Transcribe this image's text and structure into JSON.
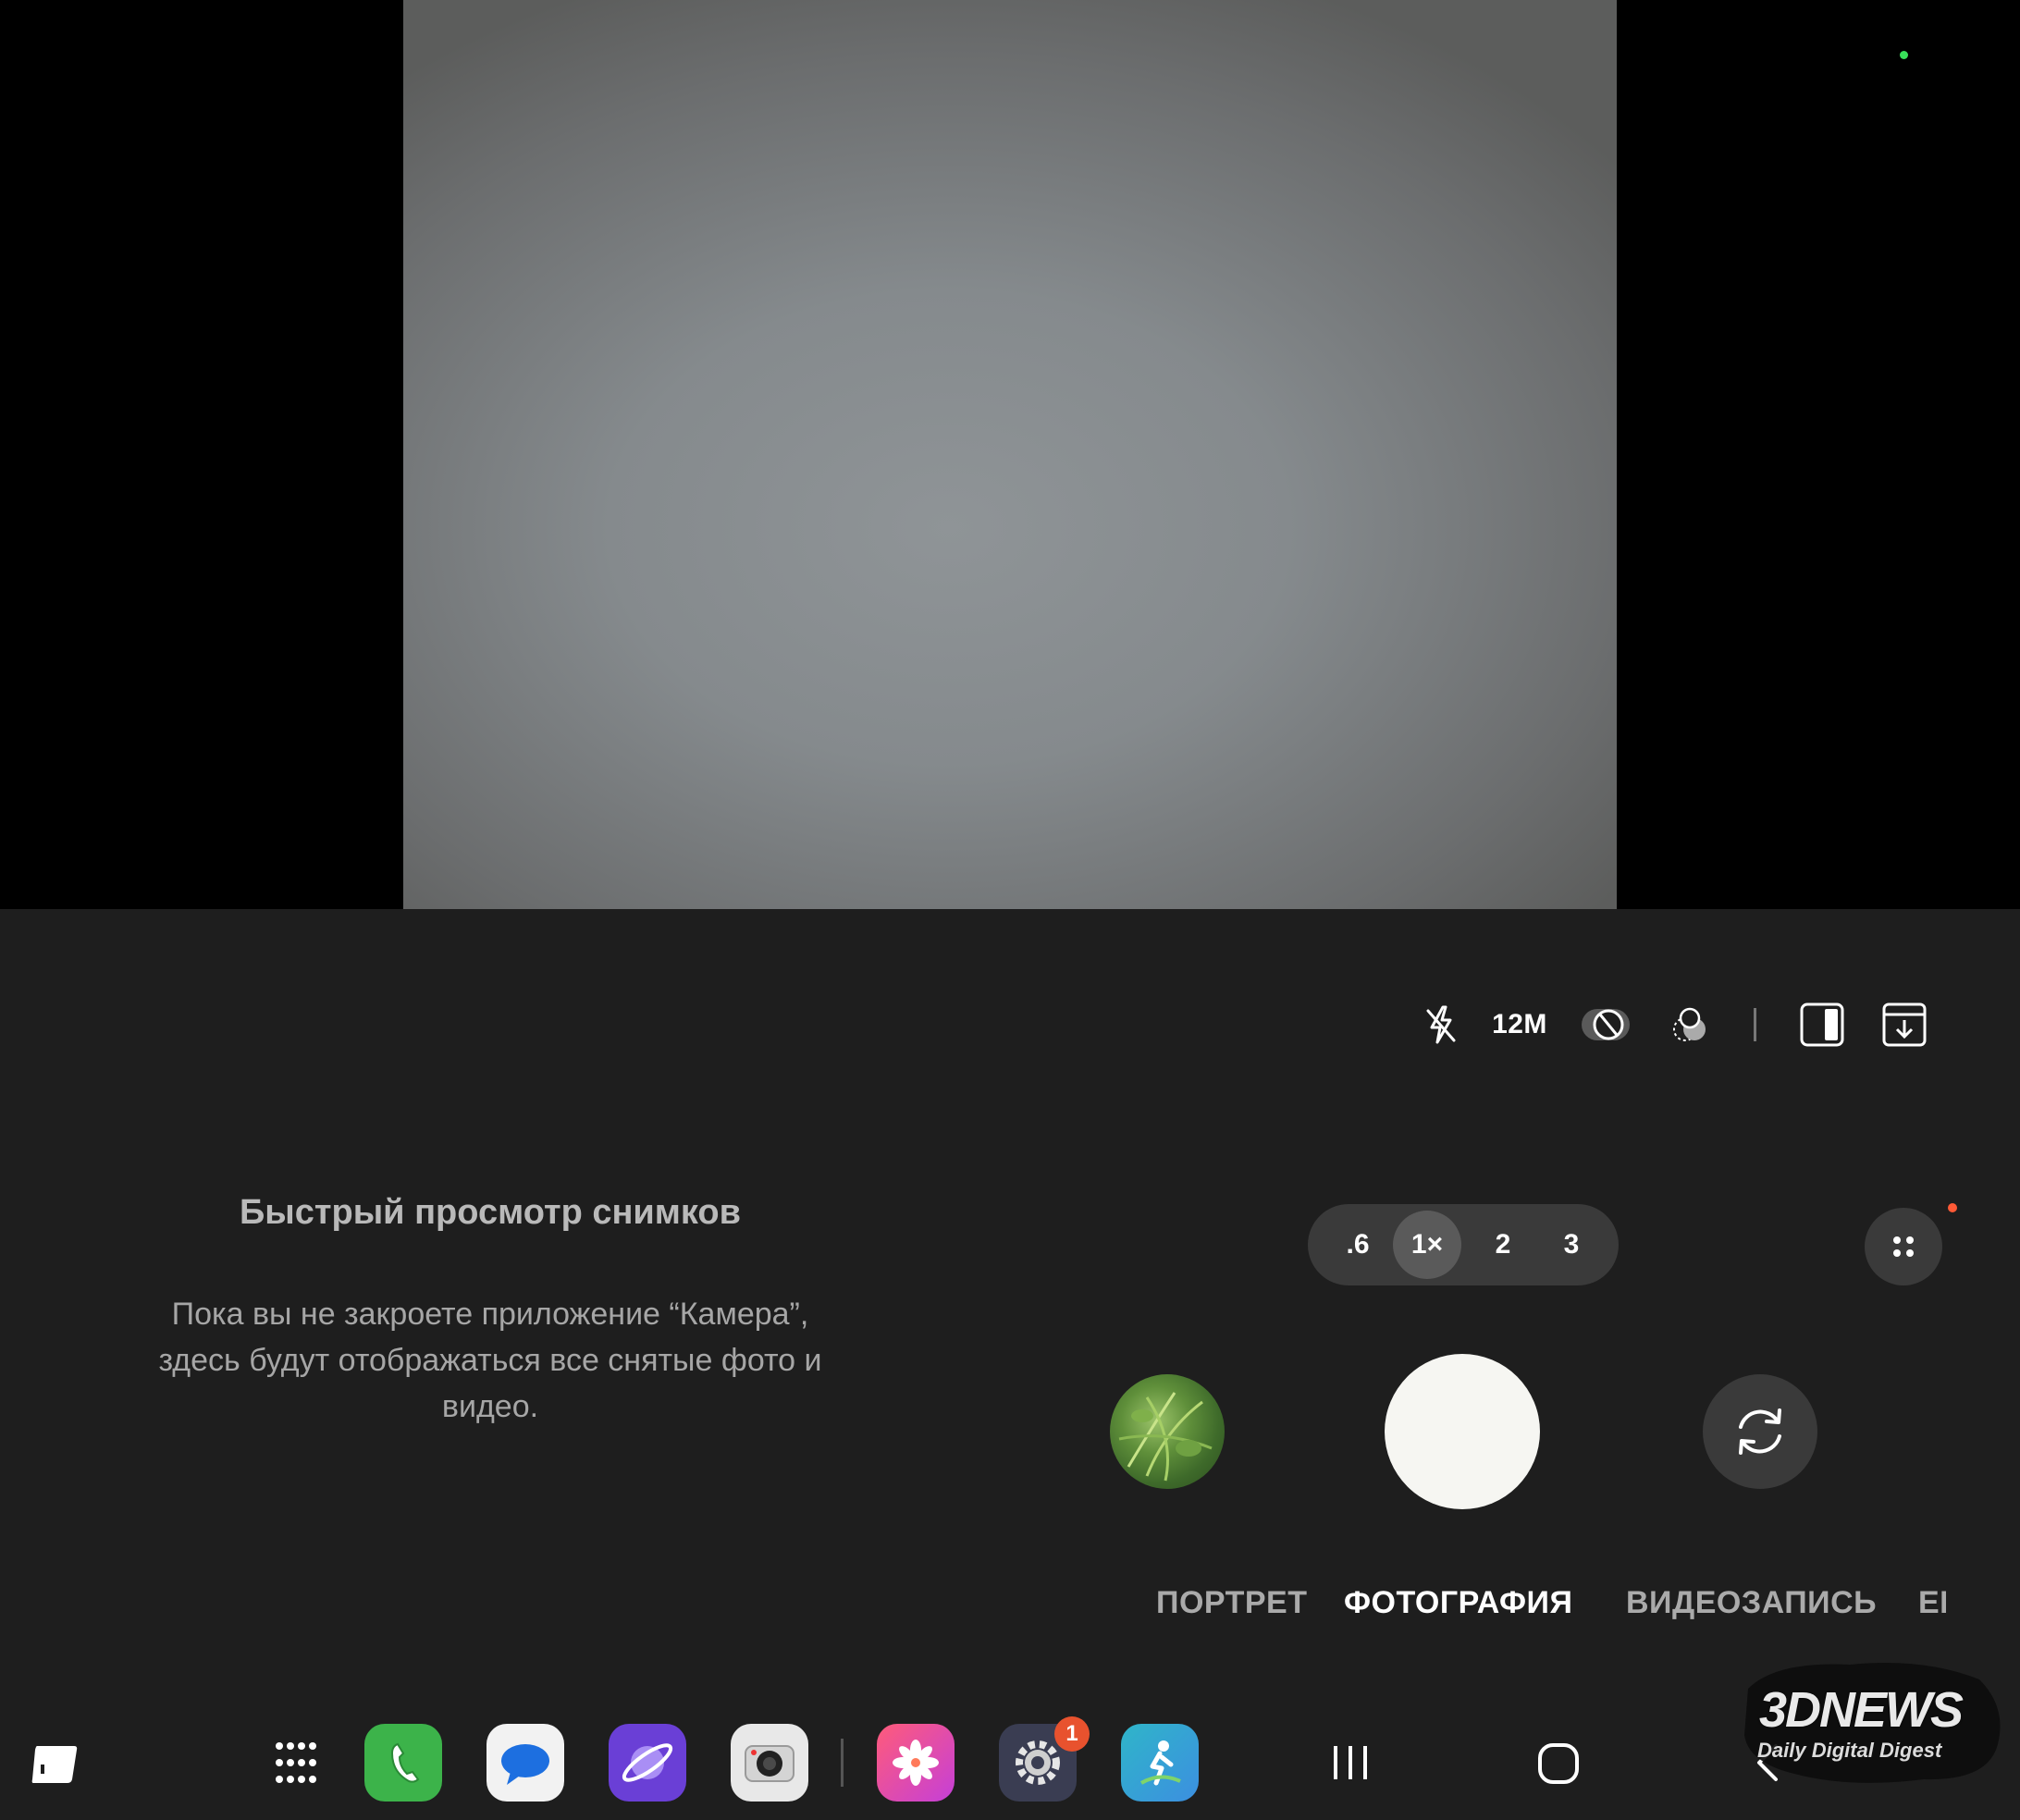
{
  "quick_settings": {
    "flash_icon": "flash-off-icon",
    "resolution": "12M",
    "icons": [
      "motion-photo-off-icon",
      "filters-icon",
      "aspect-ratio-icon",
      "save-options-icon"
    ]
  },
  "quick_preview": {
    "title": "Быстрый просмотр снимков",
    "body": "Пока вы не закроете приложение “Камера”, здесь будут отображаться все снятые фото и видео."
  },
  "zoom": {
    "options": [
      ".6",
      "1×",
      "2",
      "3"
    ],
    "selected": "1×"
  },
  "modes": {
    "portrait": "ПОРТРЕТ",
    "photo": "ФОТОГРАФИЯ",
    "video": "ВИДЕОЗАПИСЬ",
    "more_cut": "ЕЩЁ",
    "selected": "ФОТОГРАФИЯ"
  },
  "taskbar": {
    "apps": [
      "apps-grid-icon",
      "phone-icon",
      "messages-icon",
      "internet-icon",
      "camera-icon",
      "gallery-icon",
      "settings-icon",
      "fitness-icon"
    ],
    "settings_badge": "1",
    "nav": [
      "recents-icon",
      "home-icon",
      "back-icon"
    ]
  },
  "watermark": {
    "brand": "3DNEWS",
    "tagline": "Daily Digital Digest"
  },
  "colors": {
    "panel": "#1e1e1e",
    "accent_dot": "#39e05a",
    "notification": "#ff5a36",
    "badge": "#e8522e"
  }
}
